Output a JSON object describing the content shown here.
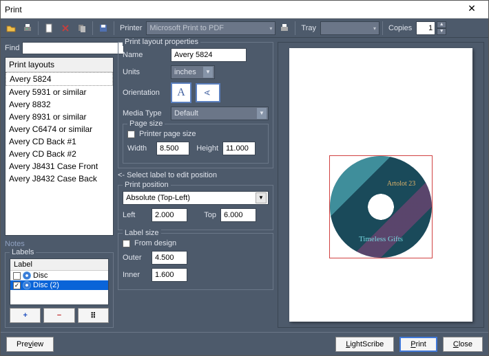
{
  "window": {
    "title": "Print"
  },
  "toolbar": {
    "printer_label": "Printer",
    "printer_value": "Microsoft Print to PDF",
    "tray_label": "Tray",
    "tray_value": "",
    "copies_label": "Copies",
    "copies_value": "1"
  },
  "find": {
    "label": "Find",
    "value": ""
  },
  "layouts": {
    "header": "Print layouts",
    "items": [
      "Avery 5824",
      "Avery 5931 or similar",
      "Avery 8832",
      "Avery 8931 or similar",
      "Avery C6474 or similar",
      "Avery CD Back #1",
      "Avery CD Back #2",
      "Avery J8431 Case Front",
      "Avery J8432 Case Back"
    ],
    "selected_index": 0
  },
  "notes_label": "Notes",
  "labels": {
    "legend": "Labels",
    "header": "Label",
    "items": [
      {
        "checked": false,
        "name": "Disc"
      },
      {
        "checked": true,
        "name": "Disc (2)"
      }
    ],
    "selected_index": 1,
    "btn_add": "+",
    "btn_remove": "−",
    "btn_grid": "⠿"
  },
  "props": {
    "legend": "Print layout properties",
    "name_label": "Name",
    "name_value": "Avery 5824",
    "units_label": "Units",
    "units_value": "inches",
    "orient_label": "Orientation",
    "media_label": "Media Type",
    "media_value": "Default",
    "pagesize": {
      "legend": "Page size",
      "printer_cb_label": "Printer page size",
      "printer_cb_checked": false,
      "width_label": "Width",
      "width_value": "8.500",
      "height_label": "Height",
      "height_value": "11.000"
    }
  },
  "position": {
    "hint": "<- Select label to edit position",
    "legend": "Print position",
    "mode": "Absolute (Top-Left)",
    "left_label": "Left",
    "left_value": "2.000",
    "top_label": "Top",
    "top_value": "6.000"
  },
  "size": {
    "legend": "Label size",
    "from_design_label": "From design",
    "from_design_checked": false,
    "outer_label": "Outer",
    "outer_value": "4.500",
    "inner_label": "Inner",
    "inner_value": "1.600"
  },
  "disc": {
    "line1": "Artolot 23",
    "line2": "Timeless Gifts"
  },
  "footer": {
    "preview": "Preview",
    "lightscribe": "LightScribe",
    "print": "Print",
    "close": "Close"
  }
}
